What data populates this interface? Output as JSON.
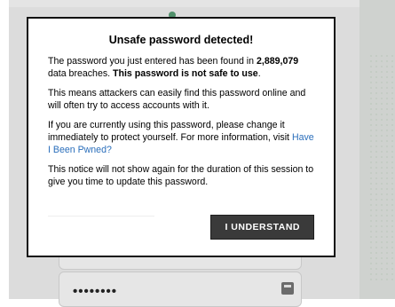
{
  "background": {
    "password_mask": "••••••••"
  },
  "dialog": {
    "title": "Unsafe password detected!",
    "p1": {
      "pre": "The password you just entered has been found in ",
      "count": "2,889,079",
      "mid": " data breaches. ",
      "bold": "This password is not safe to use",
      "end": "."
    },
    "p2": "This means attackers can easily find this password online and will often try to access accounts with it.",
    "p3": {
      "text": "If you are currently using this password, please change it immediately to protect yourself. For more information, visit ",
      "link": "Have I Been Pwned?"
    },
    "p4": "This notice will not show again for the duration of this session to give you time to update this password.",
    "button_label": "I UNDERSTAND"
  }
}
